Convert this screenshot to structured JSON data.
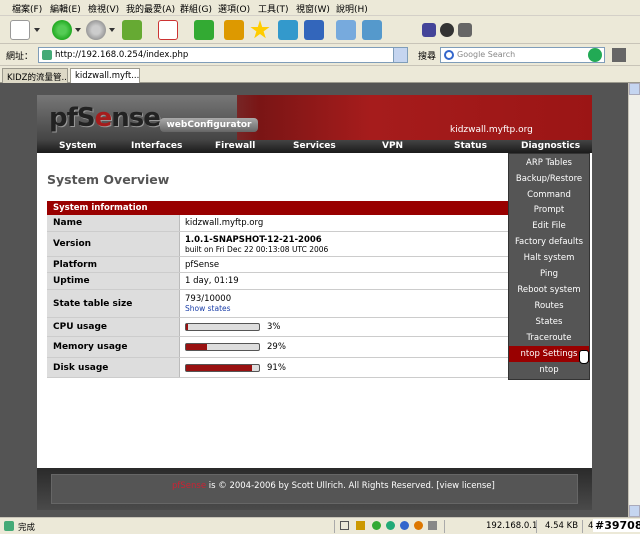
{
  "menubar": [
    "檔案(F)",
    "編輯(E)",
    "檢視(V)",
    "我的最愛(A)",
    "群組(G)",
    "選項(O)",
    "工具(T)",
    "視窗(W)",
    "說明(H)"
  ],
  "address": {
    "label": "網址：",
    "url": "http://192.168.0.254/index.php"
  },
  "search": {
    "label": "搜尋",
    "placeholder": "Google Search"
  },
  "tabs": [
    "KIDZ的流量管...",
    "kidzwall.myft..."
  ],
  "header": {
    "logo_pf": "pfS",
    "logo_e": "e",
    "logo_rest": "nse",
    "webconfigurator": "webConfigurator",
    "hostname": "kidzwall.myftp.org"
  },
  "nav": [
    "System",
    "Interfaces",
    "Firewall",
    "Services",
    "VPN",
    "Status",
    "Diagnostics"
  ],
  "page_title": "System Overview",
  "sysinfo": {
    "header": "System information",
    "name": {
      "label": "Name",
      "value": "kidzwall.myftp.org"
    },
    "version": {
      "label": "Version",
      "value": "1.0.1-SNAPSHOT-12-21-2006",
      "built": "built on Fri Dec 22 00:13:08 UTC 2006"
    },
    "platform": {
      "label": "Platform",
      "value": "pfSense"
    },
    "uptime": {
      "label": "Uptime",
      "value": "1 day, 01:19"
    },
    "state_table": {
      "label": "State table size",
      "value": "793/10000",
      "link": "Show states"
    },
    "cpu": {
      "label": "CPU usage",
      "value": "3%",
      "fraction": 0.03
    },
    "memory": {
      "label": "Memory usage",
      "value": "29%",
      "fraction": 0.29
    },
    "disk": {
      "label": "Disk usage",
      "value": "91%",
      "fraction": 0.91
    }
  },
  "diagnostics_menu": [
    "ARP Tables",
    "Backup/Restore",
    "Command",
    "Prompt",
    "Edit File",
    "Factory defaults",
    "Halt system",
    "Ping",
    "Reboot system",
    "Routes",
    "States",
    "Traceroute",
    "ntop Settings",
    "ntop"
  ],
  "footer": {
    "brand": "pfSense",
    "text": " is © 2004-2006 by Scott Ullrich. All Rights Reserved. [view license]"
  },
  "status": {
    "text": "完成",
    "ip": "192.168.0.1",
    "size": "4.54 KB",
    "extra": "4",
    "watermark": "#39708"
  },
  "colors": {
    "accent": "#990000",
    "highlight": "#a61c1c",
    "menu_bg": "#555555"
  }
}
